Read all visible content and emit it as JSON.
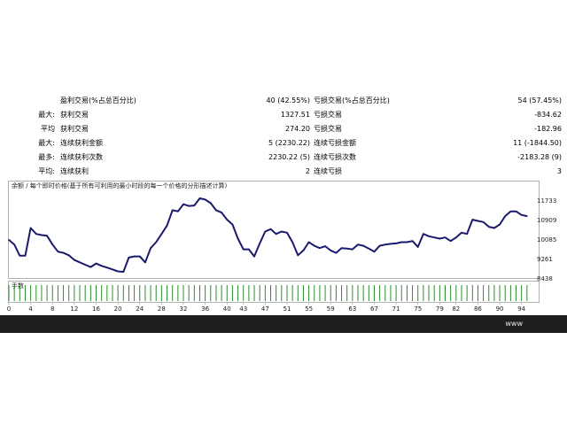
{
  "stats": {
    "rows": [
      {
        "label": "",
        "name1": "盈利交易(%占总百分比)",
        "value1": "40 (42.55%)",
        "name2": "亏损交易(%占总百分比)",
        "value2": "54 (57.45%)"
      },
      {
        "label": "最大:",
        "name1": "获利交易",
        "value1": "1327.51",
        "name2": "亏损交易",
        "value2": "-834.62"
      },
      {
        "label": "平均",
        "name1": "获利交易",
        "value1": "274.20",
        "name2": "亏损交易",
        "value2": "-182.96"
      },
      {
        "label": "最大:",
        "name1": "连续获利金额",
        "value1": "5 (2230.22)",
        "name2": "连续亏损金额",
        "value2": "11 (-1844.50)"
      },
      {
        "label": "最多:",
        "name1": "连续获利次数",
        "value1": "2230.22 (5)",
        "name2": "连续亏损次数",
        "value2": "-2183.28 (9)"
      },
      {
        "label": "平均:",
        "name1": "连续获利",
        "value1": "2",
        "name2": "连续亏损",
        "value2": "3"
      }
    ]
  },
  "chart_data": {
    "type": "line",
    "title": "余额 / 每个即时价格(基于所有可利用的最小时段的每一个价格的分形描述计算)",
    "volume_label": "手数",
    "line_color": "#1a1a6e",
    "volume_color": "#2e8b2e",
    "ylim": [
      8438,
      12100
    ],
    "y_ticks": [
      11733,
      10909,
      10085,
      9261,
      8438
    ],
    "x_ticks": [
      0,
      4,
      8,
      12,
      16,
      20,
      24,
      28,
      32,
      36,
      40,
      43,
      47,
      51,
      55,
      59,
      63,
      67,
      71,
      75,
      79,
      82,
      86,
      90,
      94
    ],
    "xlim": [
      0,
      96
    ],
    "x": [
      0,
      1,
      2,
      3,
      4,
      5,
      6,
      7,
      8,
      9,
      10,
      11,
      12,
      13,
      14,
      15,
      16,
      17,
      18,
      19,
      20,
      21,
      22,
      23,
      24,
      25,
      26,
      27,
      28,
      29,
      30,
      31,
      32,
      33,
      34,
      35,
      36,
      37,
      38,
      39,
      40,
      41,
      42,
      43,
      44,
      45,
      46,
      47,
      48,
      49,
      50,
      51,
      52,
      53,
      54,
      55,
      56,
      57,
      58,
      59,
      60,
      61,
      62,
      63,
      64,
      65,
      66,
      67,
      68,
      69,
      70,
      71,
      72,
      73,
      74,
      75,
      76,
      77,
      78,
      79,
      80,
      81,
      82,
      83,
      84,
      85,
      86,
      87,
      88,
      89,
      90,
      91,
      92,
      93,
      94,
      95
    ],
    "y": [
      10050,
      9850,
      9380,
      9380,
      10550,
      10300,
      10250,
      10220,
      9850,
      9550,
      9500,
      9400,
      9200,
      9100,
      9000,
      8900,
      9050,
      8950,
      8880,
      8800,
      8720,
      8700,
      9300,
      9350,
      9350,
      9100,
      9700,
      9950,
      10300,
      10650,
      11300,
      11250,
      11550,
      11480,
      11500,
      11800,
      11750,
      11600,
      11300,
      11200,
      10900,
      10700,
      10100,
      9650,
      9650,
      9350,
      9900,
      10400,
      10500,
      10300,
      10400,
      10350,
      9950,
      9400,
      9600,
      9950,
      9800,
      9700,
      9780,
      9600,
      9500,
      9700,
      9680,
      9650,
      9850,
      9800,
      9680,
      9550,
      9800,
      9850,
      9880,
      9900,
      9950,
      9950,
      10000,
      9750,
      10300,
      10200,
      10150,
      10100,
      10150,
      10000,
      10150,
      10350,
      10300,
      10900,
      10850,
      10800,
      10600,
      10550,
      10700,
      11050,
      11250,
      11250,
      11100,
      11050
    ]
  },
  "footer": {
    "text": "www"
  }
}
